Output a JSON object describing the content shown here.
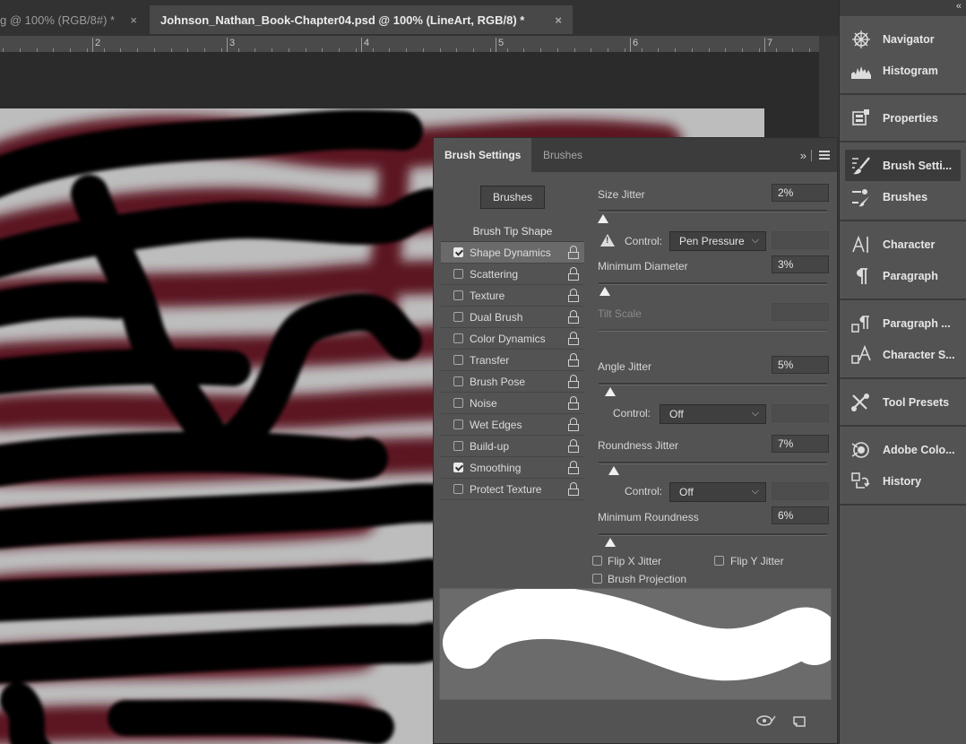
{
  "tabs": [
    {
      "title": "g @ 100% (RGB/8#) *",
      "close": "×",
      "active": false
    },
    {
      "title": "Johnson_Nathan_Book-Chapter04.psd @ 100% (LineArt, RGB/8) *",
      "close": "×",
      "active": true
    }
  ],
  "ruler": {
    "labels": [
      "2",
      "3",
      "4",
      "5",
      "6",
      "7"
    ]
  },
  "brush_settings": {
    "tab_active": "Brush Settings",
    "tab_other": "Brushes",
    "expand_glyph": "»",
    "brushes_button": "Brushes",
    "tip_shape": "Brush Tip Shape",
    "options": [
      {
        "label": "Shape Dynamics",
        "checked": true,
        "selected": true
      },
      {
        "label": "Scattering",
        "checked": false
      },
      {
        "label": "Texture",
        "checked": false
      },
      {
        "label": "Dual Brush",
        "checked": false
      },
      {
        "label": "Color Dynamics",
        "checked": false
      },
      {
        "label": "Transfer",
        "checked": false
      },
      {
        "label": "Brush Pose",
        "checked": false
      },
      {
        "label": "Noise",
        "checked": false
      },
      {
        "label": "Wet Edges",
        "checked": false
      },
      {
        "label": "Build-up",
        "checked": false
      },
      {
        "label": "Smoothing",
        "checked": true
      },
      {
        "label": "Protect Texture",
        "checked": false
      }
    ],
    "size_jitter": {
      "label": "Size Jitter",
      "value": "2%"
    },
    "control_1": {
      "label": "Control:",
      "value": "Pen Pressure"
    },
    "min_diameter": {
      "label": "Minimum Diameter",
      "value": "3%"
    },
    "tilt_scale": {
      "label": "Tilt Scale",
      "value": ""
    },
    "angle_jitter": {
      "label": "Angle Jitter",
      "value": "5%"
    },
    "control_2": {
      "label": "Control:",
      "value": "Off"
    },
    "roundness_jitter": {
      "label": "Roundness Jitter",
      "value": "7%"
    },
    "control_3": {
      "label": "Control:",
      "value": "Off"
    },
    "min_roundness": {
      "label": "Minimum Roundness",
      "value": "6%"
    },
    "flip_x": {
      "label": "Flip X Jitter",
      "checked": false
    },
    "flip_y": {
      "label": "Flip Y Jitter",
      "checked": false
    },
    "brush_projection": {
      "label": "Brush Projection",
      "checked": false
    }
  },
  "dock": {
    "collapse_glyph": "«",
    "groups": [
      [
        {
          "label": "Navigator",
          "icon": "navigator-icon"
        },
        {
          "label": "Histogram",
          "icon": "histogram-icon"
        }
      ],
      [
        {
          "label": "Properties",
          "icon": "properties-icon"
        }
      ],
      [
        {
          "label": "Brush Setti...",
          "icon": "brush-settings-icon",
          "active": true
        },
        {
          "label": "Brushes",
          "icon": "brushes-icon"
        }
      ],
      [
        {
          "label": "Character",
          "icon": "character-icon"
        },
        {
          "label": "Paragraph",
          "icon": "paragraph-icon"
        }
      ],
      [
        {
          "label": "Paragraph ...",
          "icon": "paragraph-styles-icon"
        },
        {
          "label": "Character S...",
          "icon": "character-styles-icon"
        }
      ],
      [
        {
          "label": "Tool Presets",
          "icon": "tool-presets-icon"
        }
      ],
      [
        {
          "label": "Adobe Colo...",
          "icon": "adobe-color-icon"
        },
        {
          "label": "History",
          "icon": "history-icon"
        }
      ]
    ]
  },
  "colors": {
    "brush_red": "#5b1424",
    "stroke_black": "#050505",
    "canvas_bg": "#bdbdbd",
    "panel": "#535353"
  }
}
